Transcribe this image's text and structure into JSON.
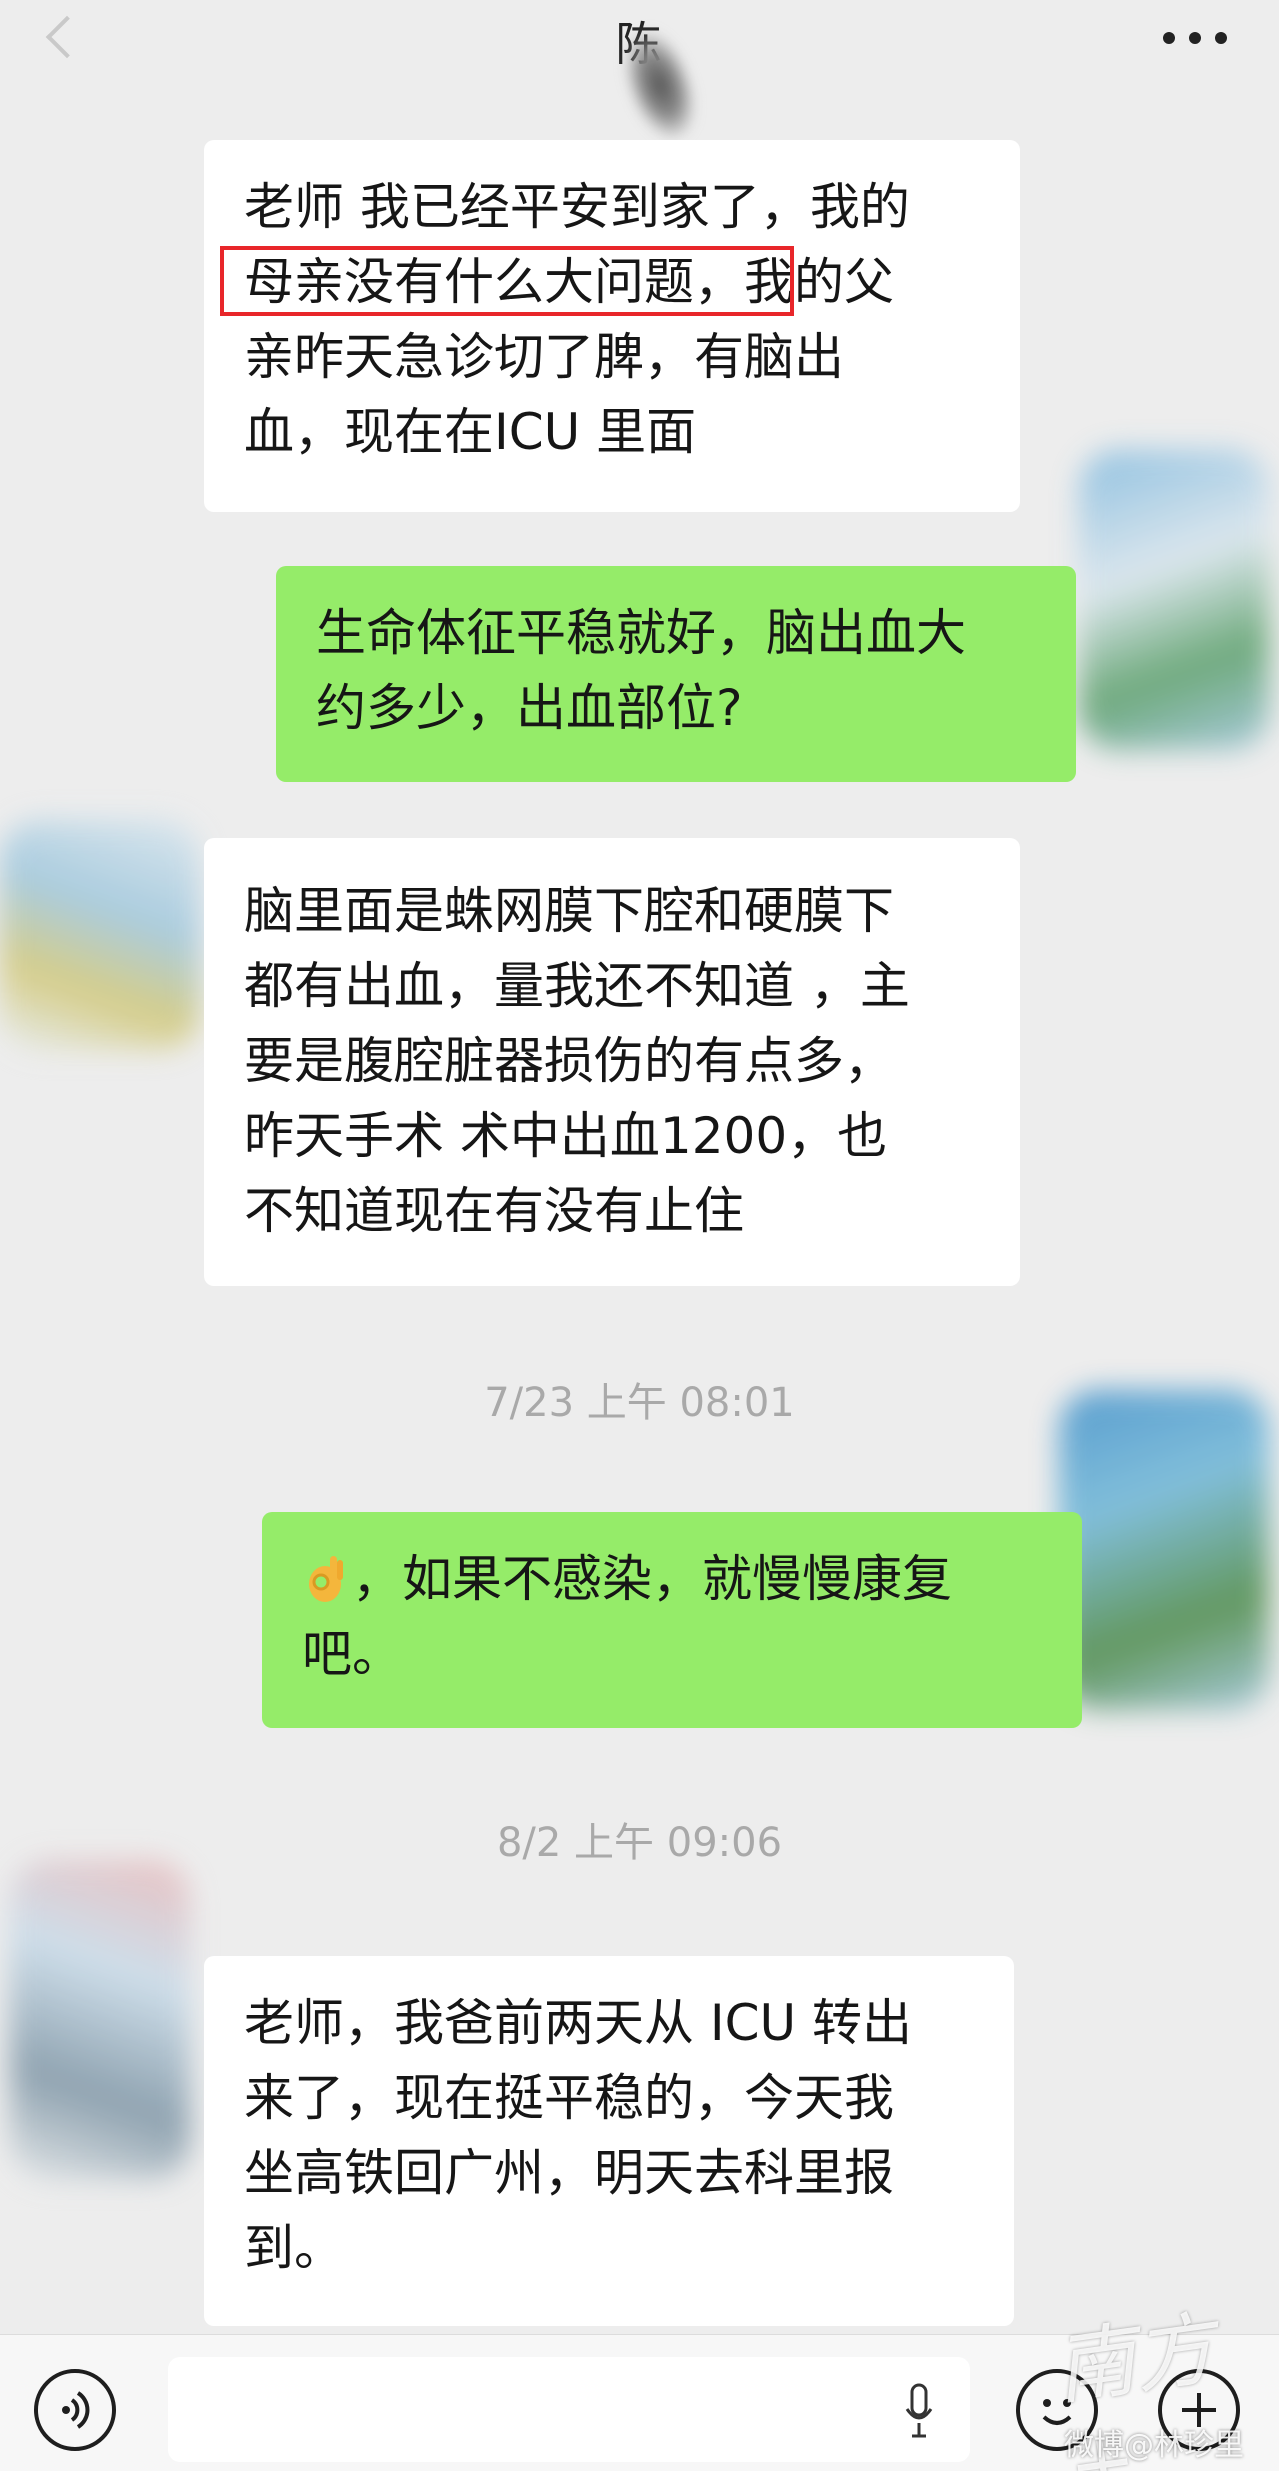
{
  "header": {
    "title": "陈"
  },
  "messages": [
    {
      "direction": "incoming",
      "text": "老师 我已经平安到家了，我的\n母亲没有什么大问题，我的父\n亲昨天急诊切了脾，有脑出\n血，现在在ICU 里面"
    },
    {
      "direction": "outgoing",
      "text": "生命体征平稳就好，脑出血大\n约多少，出血部位?"
    },
    {
      "direction": "incoming",
      "text": "脑里面是蛛网膜下腔和硬膜下\n都有出血，量我还不知道 ，主\n要是腹腔脏器损伤的有点多，\n昨天手术 术中出血1200，也\n不知道现在有没有止住"
    },
    {
      "direction": "outgoing",
      "emoji": "👌",
      "text": "，如果不感染，就慢慢康复\n吧。"
    },
    {
      "direction": "incoming",
      "text": "老师，我爸前两天从 ICU 转出\n来了，现在挺平稳的，今天我\n坐高铁回广州，明天去科里报\n到。"
    }
  ],
  "timestamps": {
    "first": "7/23 上午 08:01",
    "second": "8/2 上午 09:06"
  },
  "highlight": {
    "text": "母亲没有什么大问题，",
    "color": "#e8262a"
  },
  "bottom_bar": {
    "voice_icon": "voice-icon",
    "mic_icon": "mic-icon",
    "emoji_icon": "emoji-icon",
    "plus_icon": "plus-icon"
  },
  "watermark": {
    "logo": "南方+",
    "handle": "微博@林珍里"
  },
  "colors": {
    "background": "#ededed",
    "incoming_bubble": "#ffffff",
    "outgoing_bubble": "#95ec69",
    "timestamp": "#a9a9a9"
  }
}
